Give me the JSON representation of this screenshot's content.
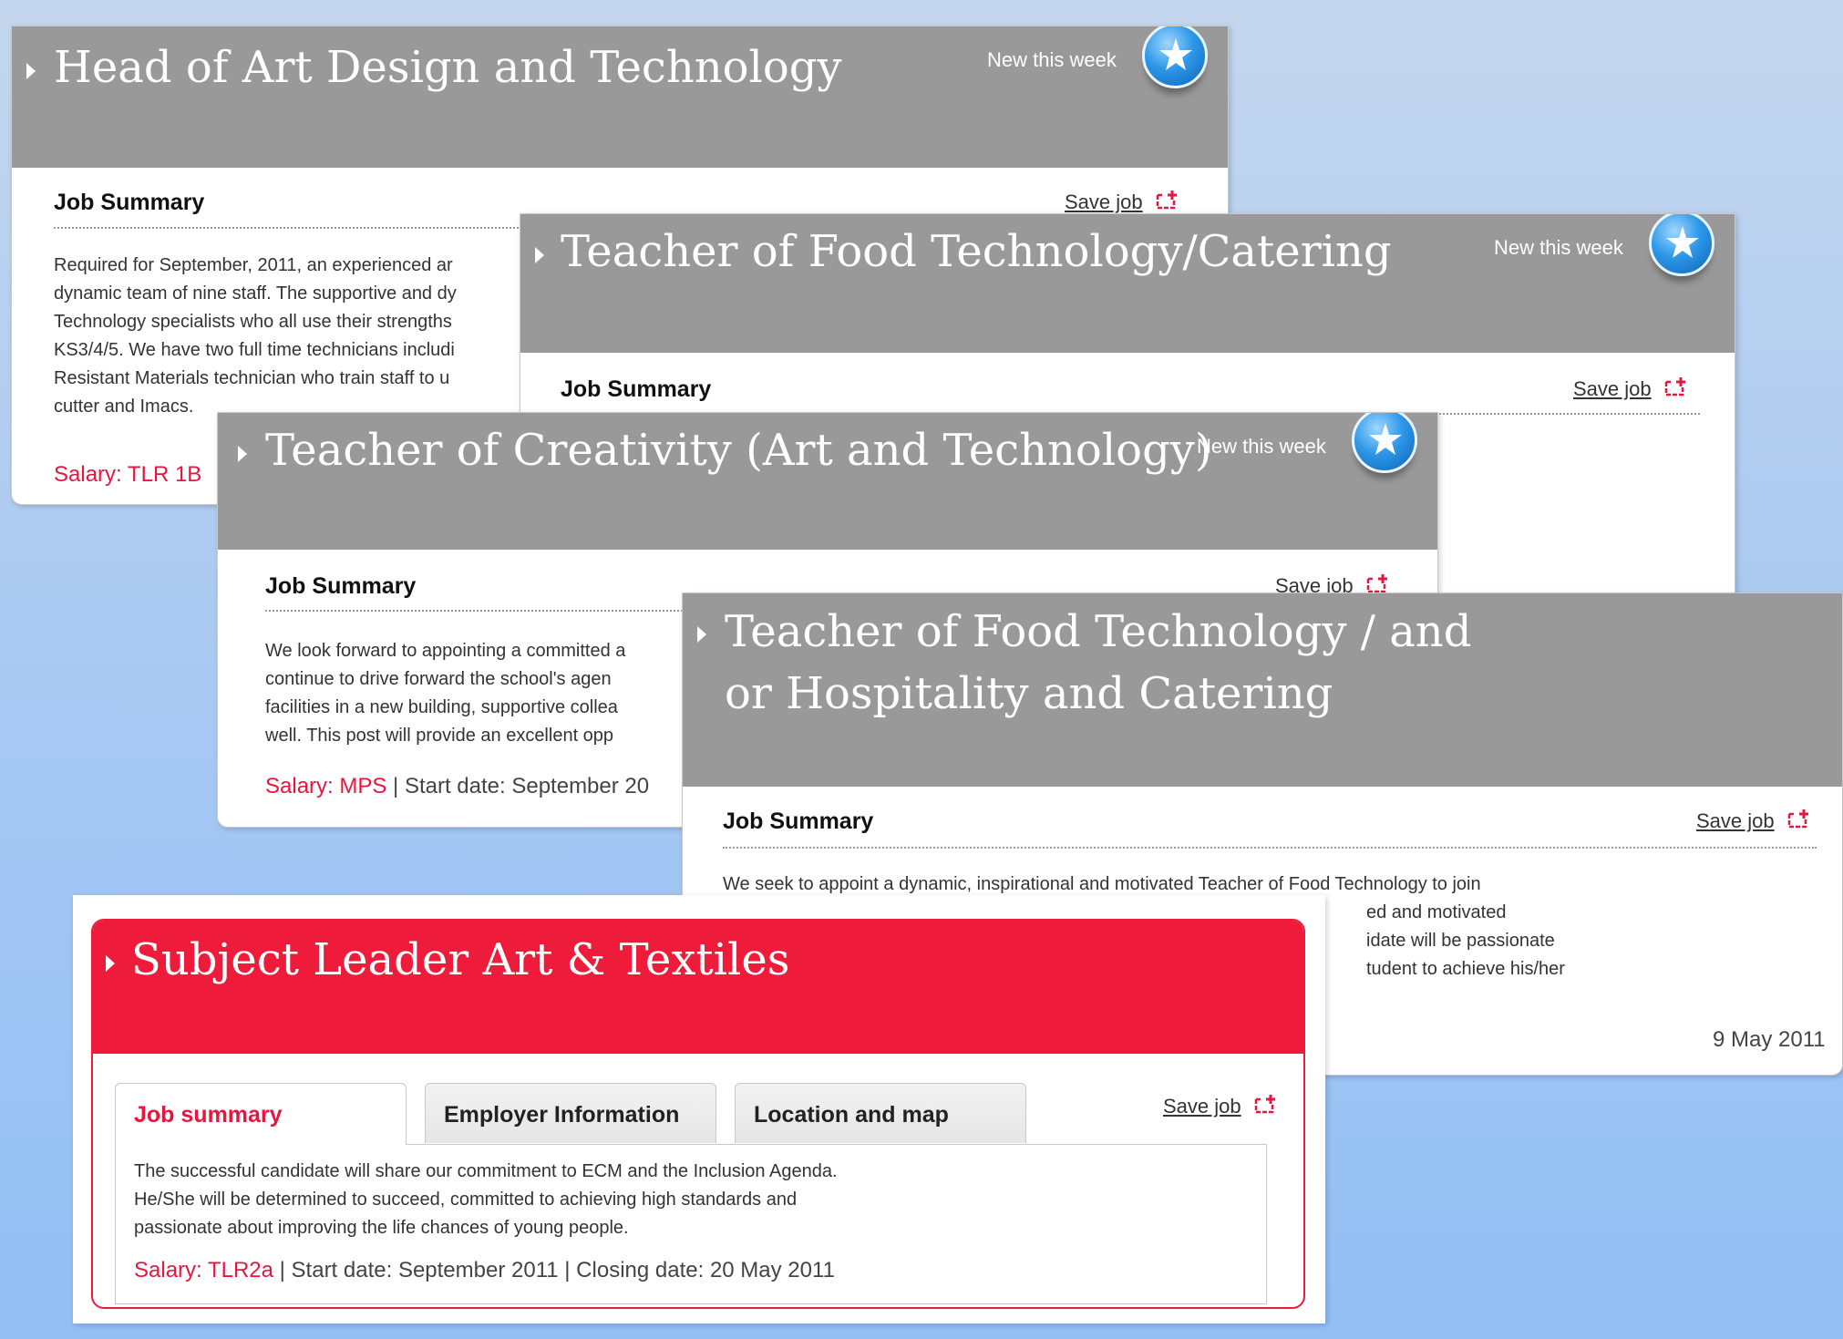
{
  "cards": {
    "head_art": {
      "title": "Head of Art Design and Technology",
      "new_label": "New this week",
      "summary_heading": "Job Summary",
      "save_label": "Save job",
      "lines": [
        "Required for September, 2011, an experienced ar",
        "dynamic team of nine staff. The supportive and dy",
        "Technology specialists who all use their strengths",
        "KS3/4/5. We have two full time technicians includi",
        "Resistant Materials technician who train staff to u",
        "cutter and Imacs."
      ],
      "salary": "Salary: TLR 1B"
    },
    "food_catering": {
      "title": "Teacher of Food Technology/Catering",
      "new_label": "New this week",
      "summary_heading": "Job Summary",
      "save_label": "Save job"
    },
    "creativity": {
      "title": "Teacher of Creativity (Art and Technology)",
      "new_label": "New this week",
      "summary_heading": "Job Summary",
      "save_label": "Save job",
      "lines": [
        "We look forward to appointing a committed a",
        "continue to drive forward the school's agen",
        "facilities in a new building, supportive collea",
        "well.  This post will provide an excellent opp"
      ],
      "salary": "Salary: MPS",
      "rest": " | Start date: September 20"
    },
    "food_hospitality": {
      "title": "Teacher of Food Technology / and or Hospitality and Catering",
      "summary_heading": "Job Summary",
      "save_label": "Save job",
      "lines": [
        "We seek to appoint a dynamic, inspirational and motivated Teacher of Food Technology to join",
        "ed and motivated",
        "idate will be passionate",
        "tudent to achieve his/her"
      ],
      "date_fragment": "9 May 2011"
    },
    "art_textiles": {
      "title": "Subject Leader Art & Textiles",
      "tabs": [
        "Job summary",
        "Employer Information",
        "Location and map"
      ],
      "save_label": "Save job",
      "lines": [
        "The successful candidate will share our commitment to ECM and the Inclusion Agenda.",
        "He/She will be determined to succeed, committed to achieving high standards and",
        "passionate about improving the life chances of young people."
      ],
      "salary": "Salary: TLR2a",
      "rest": " | Start date: September 2011  | Closing date: 20 May 2011"
    }
  },
  "colors": {
    "header_grey": "#999999",
    "header_red": "#ee1b3b",
    "salary_red": "#e5173f",
    "badge_blue": "#2f98e8"
  }
}
